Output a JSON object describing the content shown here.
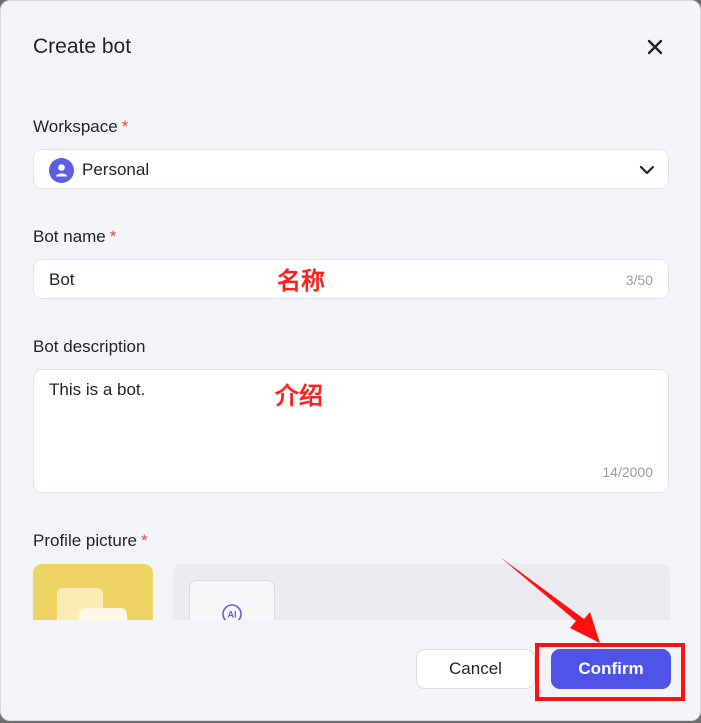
{
  "dialog": {
    "title": "Create bot",
    "close_icon": "close-icon"
  },
  "workspace": {
    "label": "Workspace",
    "required_mark": "*",
    "selected": "Personal",
    "avatar_icon": "user-icon",
    "dropdown_icon": "chevron-down-icon"
  },
  "bot_name": {
    "label": "Bot name",
    "required_mark": "*",
    "value": "Bot",
    "counter": "3/50"
  },
  "bot_description": {
    "label": "Bot description",
    "value": "This is a bot.",
    "counter": "14/2000"
  },
  "profile_picture": {
    "label": "Profile picture",
    "required_mark": "*",
    "ai_icon": "ai-icon"
  },
  "annotations": {
    "name_note": "名称",
    "description_note": "介绍"
  },
  "footer": {
    "cancel_label": "Cancel",
    "confirm_label": "Confirm"
  },
  "colors": {
    "accent": "#4f53e8",
    "required": "#f04438",
    "annotation": "#ff1010"
  }
}
